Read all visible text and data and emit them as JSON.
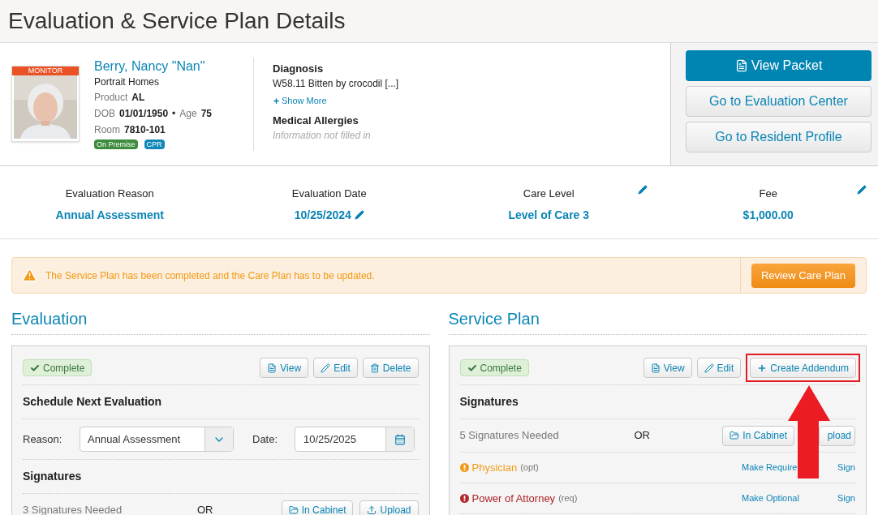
{
  "page": {
    "title": "Evaluation & Service Plan Details"
  },
  "resident": {
    "flag": "MONITOR",
    "name": "Berry, Nancy \"Nan\"",
    "facility": "Portrait Homes",
    "lines": [
      [
        {
          "label": "Product",
          "value": "AL"
        }
      ],
      [
        {
          "label": "DOB",
          "value": "01/01/1950"
        },
        {
          "label": "Age",
          "value": "75"
        }
      ],
      [
        {
          "label": "Room",
          "value": "7810-101"
        }
      ]
    ],
    "separator": "•",
    "tags": [
      {
        "label": "On Premise",
        "color": "#3d8b3d"
      },
      {
        "label": "CPR",
        "color": "#1288b8"
      }
    ]
  },
  "diagnosis": {
    "label": "Diagnosis",
    "value": "W58.11 Bitten by crocodil [...]",
    "show_more": "Show More"
  },
  "allergies": {
    "label": "Medical Allergies",
    "empty_text": "Information not filled in"
  },
  "actions": [
    {
      "label": "View Packet",
      "kind": "primary"
    },
    {
      "label": "Go to Evaluation Center",
      "kind": "default"
    },
    {
      "label": "Go to Resident Profile",
      "kind": "default"
    }
  ],
  "summary": [
    {
      "label": "Evaluation Reason",
      "value": "Annual Assessment",
      "kind": "plain"
    },
    {
      "label": "Evaluation Date",
      "value": "10/25/2024",
      "kind": "inline"
    },
    {
      "label": "Care Level",
      "value": "Level of Care 3",
      "kind": "corner"
    },
    {
      "label": "Fee",
      "value": "$1,000.00",
      "kind": "corner"
    }
  ],
  "alert": {
    "message": "The Service Plan has been completed and the Care Plan has to be updated.",
    "button": "Review Care Plan"
  },
  "evaluation": {
    "heading": "Evaluation",
    "status": "Complete",
    "buttons": [
      {
        "label": "View",
        "kind": "view"
      },
      {
        "label": "Edit",
        "kind": "edit"
      },
      {
        "label": "Delete",
        "kind": "delete"
      }
    ],
    "schedule": {
      "heading": "Schedule Next Evaluation",
      "reason_label": "Reason:",
      "reason": "Annual Assessment",
      "date_label": "Date:",
      "date": "10/25/2025"
    },
    "signatures": {
      "heading": "Signatures",
      "needed": "3 Signatures Needed",
      "or": "OR",
      "buttons": [
        {
          "label": "In Cabinet",
          "kind": "cabinet"
        },
        {
          "label": "Upload",
          "kind": "upload"
        }
      ]
    }
  },
  "service_plan": {
    "heading": "Service Plan",
    "status": "Complete",
    "buttons": [
      {
        "label": "View",
        "kind": "view"
      },
      {
        "label": "Edit",
        "kind": "edit"
      },
      {
        "label": "Create Addendum",
        "kind": "add",
        "highlighted": true
      }
    ],
    "signatures": {
      "heading": "Signatures",
      "needed": "5 Signatures Needed",
      "or": "OR",
      "buttons": [
        {
          "label": "In Cabinet",
          "kind": "cabinet"
        },
        {
          "label": "pload",
          "kind": "covered"
        }
      ],
      "signers": [
        {
          "name": "Physician",
          "flag": "(opt)",
          "required": false,
          "toggle": "Make Require",
          "action": "Sign"
        },
        {
          "name": "Power of Attorney",
          "flag": "(req)",
          "required": true,
          "toggle": "Make Optional",
          "action": "Sign"
        }
      ]
    }
  }
}
